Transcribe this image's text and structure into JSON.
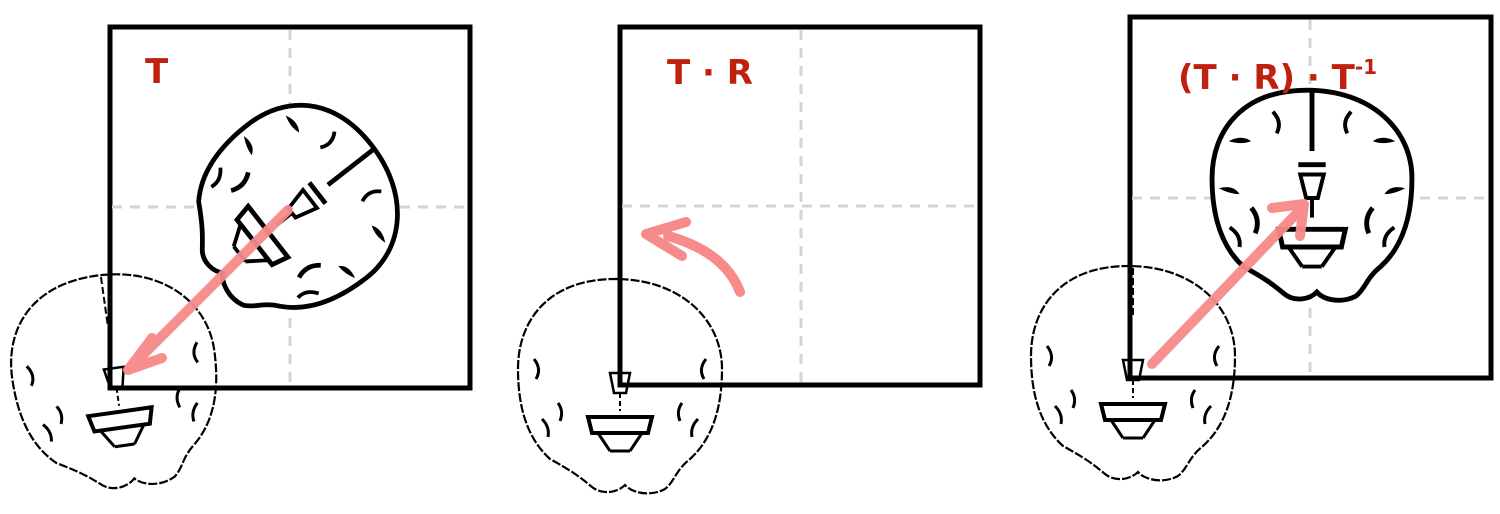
{
  "panels": [
    {
      "label_main": "T",
      "label_sup": "",
      "motion": "translate"
    },
    {
      "label_main": "T · R",
      "label_sup": "",
      "motion": "rotate"
    },
    {
      "label_main": "(T · R) · T",
      "label_sup": "-1",
      "motion": "translate-back"
    }
  ],
  "colors": {
    "label": "#c0200e",
    "arrow": "#f78a8a",
    "frame": "#000000",
    "crosshair": "#d4d4d4"
  },
  "icons": [
    "brain-slice-icon",
    "brain-outline-icon"
  ]
}
